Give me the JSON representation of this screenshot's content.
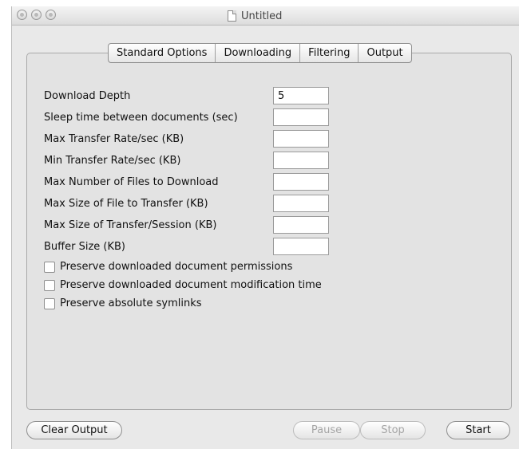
{
  "window": {
    "title": "Untitled"
  },
  "tabs": [
    "Standard Options",
    "Downloading",
    "Filtering",
    "Output"
  ],
  "fields": [
    {
      "label": "Download Depth",
      "value": "5"
    },
    {
      "label": "Sleep time between documents (sec)",
      "value": ""
    },
    {
      "label": "Max Transfer Rate/sec (KB)",
      "value": ""
    },
    {
      "label": "Min Transfer Rate/sec (KB)",
      "value": ""
    },
    {
      "label": "Max Number of Files to Download",
      "value": ""
    },
    {
      "label": "Max Size of File to Transfer (KB)",
      "value": ""
    },
    {
      "label": "Max Size of Transfer/Session (KB)",
      "value": ""
    },
    {
      "label": "Buffer Size (KB)",
      "value": ""
    }
  ],
  "checkboxes": [
    {
      "label": "Preserve downloaded document permissions",
      "checked": false
    },
    {
      "label": "Preserve downloaded document modification time",
      "checked": false
    },
    {
      "label": "Preserve absolute symlinks",
      "checked": false
    }
  ],
  "buttons": {
    "clear_output": "Clear Output",
    "pause": "Pause",
    "stop": "Stop",
    "start": "Start"
  }
}
